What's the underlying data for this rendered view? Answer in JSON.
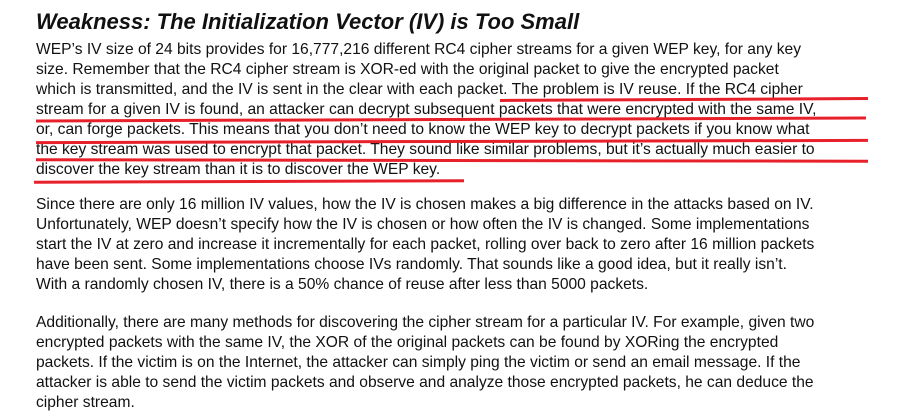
{
  "heading": "Weakness: The Initialization Vector (IV) is Too Small",
  "paragraph1": {
    "lines": [
      "WEP’s IV size of 24 bits provides for 16,777,216 different RC4 cipher streams for a given WEP key, for any key",
      "size.  Remember that the RC4 cipher stream is XOR-ed with the original packet to give the encrypted packet",
      "which is transmitted, and the IV is sent in the clear with each packet.  The problem is IV reuse.  If the RC4 cipher",
      "stream for a given IV is found, an attacker can decrypt subsequent packets that were encrypted with the same IV,",
      "or, can forge packets.  This means that you don’t need to know the WEP key to decrypt packets if you know what",
      "the key stream was used to encrypt that packet.  They sound like similar problems, but it’s actually much easier to",
      "discover the key stream than it is to discover the WEP key."
    ]
  },
  "paragraph2": {
    "lines": [
      "Since there are only 16 million IV values, how the IV is chosen makes a big difference in the attacks based on IV.",
      "Unfortunately, WEP doesn’t specify how the IV is chosen or how often the IV is changed. Some implementations",
      "start the IV at zero and increase it incrementally for each packet, rolling over back to zero after 16 million packets",
      "have been sent.  Some implementations choose IVs randomly.  That sounds like a good idea, but it really isn’t.",
      "With a randomly chosen IV, there is a 50% chance of reuse after less than 5000 packets."
    ]
  },
  "paragraph3": {
    "lines": [
      "Additionally, there are many methods for discovering the cipher stream for a particular IV.  For example, given two",
      "encrypted packets with the same IV, the XOR of the original packets can be found by XORing the encrypted",
      "packets.  If the victim is on the Internet, the attacker can simply ping the victim or send an email message.  If the",
      "attacker is able to send the victim packets and observe and analyze those encrypted packets, he can deduce the",
      "cipher stream."
    ]
  },
  "annotation_color": "#e8202a"
}
